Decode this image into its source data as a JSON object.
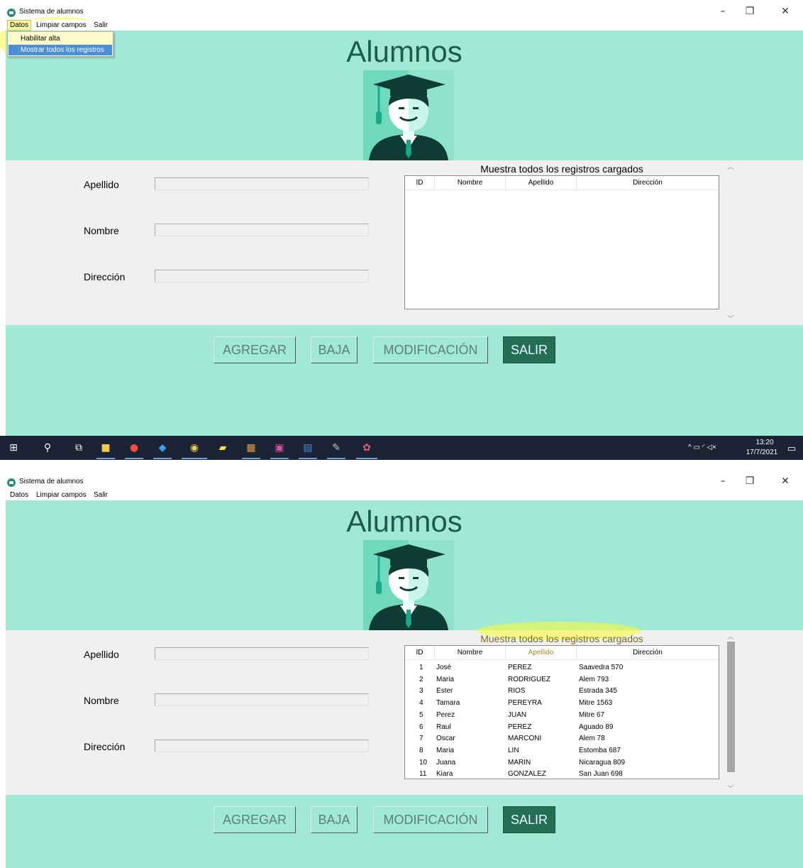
{
  "window": {
    "title": "Sistema de alumnos",
    "minimize": "–",
    "maximize": "❐",
    "close": "✕"
  },
  "menu": {
    "datos": "Datos",
    "limpiar": "Limpiar campos",
    "salir": "Salir"
  },
  "dropdown": {
    "habilitar": "Habilitar alta",
    "mostrar": "Mostrar todos los registros"
  },
  "header": {
    "title": "Alumnos"
  },
  "form": {
    "apellido_label": "Apellido",
    "nombre_label": "Nombre",
    "direccion_label": "Dirección",
    "apellido_value": "",
    "nombre_value": "",
    "direccion_value": ""
  },
  "table": {
    "caption": "Muestra todos los registros cargados",
    "columns": [
      "ID",
      "Nombre",
      "Apellido",
      "Dirección"
    ],
    "rows": [
      [
        "1",
        "José",
        "PEREZ",
        "Saavedra 570"
      ],
      [
        "2",
        "Maria",
        "RODRIGUEZ",
        "Alem 793"
      ],
      [
        "3",
        "Ester",
        "RIOS",
        "Estrada 345"
      ],
      [
        "4",
        "Tamara",
        "PEREYRA",
        "Mitre 1563"
      ],
      [
        "5",
        "Perez",
        "JUAN",
        "Mitre 67"
      ],
      [
        "6",
        "Raul",
        "PEREZ",
        "Aguado 89"
      ],
      [
        "7",
        "Oscar",
        "MARCONI",
        "Alem 78"
      ],
      [
        "8",
        "Maria",
        "LIN",
        "Estomba 687"
      ],
      [
        "10",
        "Juana",
        "MARIN",
        "Nicaragua 809"
      ],
      [
        "11",
        "Kiara",
        "GONZALEZ",
        "San Juan 698"
      ]
    ]
  },
  "buttons": {
    "agregar": "AGREGAR",
    "baja": "BAJA",
    "modificacion": "MODIFICACIÓN",
    "salir": "SALIR"
  },
  "taskbar": {
    "time": "13:20",
    "date": "17/7/2021"
  },
  "colors": {
    "mint": "#9fe9d5",
    "dark_green": "#246e58",
    "heading": "#1f5a50"
  }
}
